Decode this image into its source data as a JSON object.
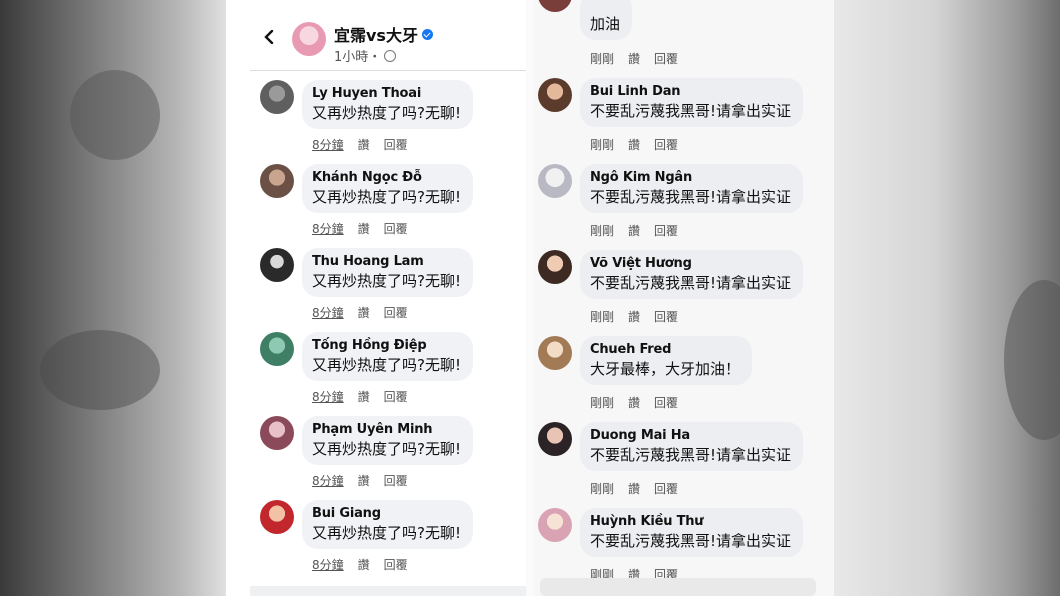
{
  "header": {
    "title": "宜霈vs大牙",
    "subtitle": "1小時・",
    "colors": {
      "verified": "#1877f2"
    }
  },
  "actions": {
    "like": "讚",
    "reply": "回覆"
  },
  "left_comments": [
    {
      "name": "Ly Huyen Thoai",
      "text": "又再炒热度了吗?无聊!",
      "time": "8分鐘"
    },
    {
      "name": "Khánh Ngọc Đỗ",
      "text": "又再炒热度了吗?无聊!",
      "time": "8分鐘"
    },
    {
      "name": "Thu Hoang Lam",
      "text": "又再炒热度了吗?无聊!",
      "time": "8分鐘"
    },
    {
      "name": "Tống Hồng Điệp",
      "text": "又再炒热度了吗?无聊!",
      "time": "8分鐘"
    },
    {
      "name": "Phạm Uyên Minh",
      "text": "又再炒热度了吗?无聊!",
      "time": "8分鐘"
    },
    {
      "name": "Bui Giang",
      "text": "又再炒热度了吗?无聊!",
      "time": "8分鐘"
    }
  ],
  "right_top": {
    "text": "加油",
    "time": "剛剛"
  },
  "right_comments": [
    {
      "name": "Bui Linh Dan",
      "text": "不要乱污蔑我黑哥!请拿出实证",
      "time": "剛剛"
    },
    {
      "name": "Ngô Kim Ngân",
      "text": "不要乱污蔑我黑哥!请拿出实证",
      "time": "剛剛"
    },
    {
      "name": "Võ Việt Hương",
      "text": "不要乱污蔑我黑哥!请拿出实证",
      "time": "剛剛"
    },
    {
      "name": "Chueh Fred",
      "text": "大牙最棒，大牙加油！",
      "time": "剛剛"
    },
    {
      "name": "Duong Mai Ha",
      "text": "不要乱污蔑我黑哥!请拿出实证",
      "time": "剛剛"
    },
    {
      "name": "Huỳnh Kiều Thư",
      "text": "不要乱污蔑我黑哥!请拿出实证",
      "time": "剛剛"
    }
  ]
}
